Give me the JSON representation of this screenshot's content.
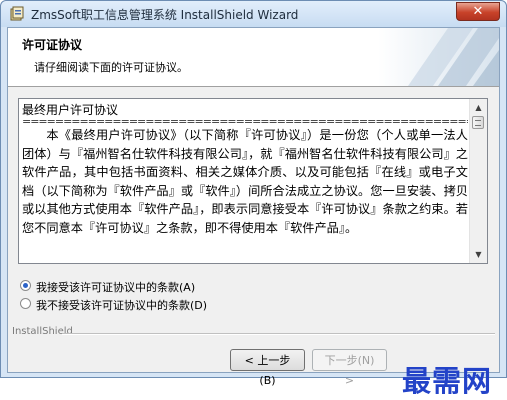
{
  "window": {
    "title": "ZmsSoft职工信息管理系统 InstallShield Wizard",
    "close_label": "✕"
  },
  "banner": {
    "title": "许可证协议",
    "subtitle": "请仔细阅读下面的许可证协议。"
  },
  "license": {
    "heading": "最终用户许可协议",
    "rule": "================================================================================",
    "body": "本《最终用户许可协议》（以下简称『许可协议』）是一份您（个人或单一法人团体）与『福州智名仕软件科技有限公司』，就『福州智名仕软件科技有限公司』之软件产品，其中包括书面资料、相关之媒体介质、以及可能包括『在线』或电子文档（以下简称为『软件产品』或『软件』）间所合法成立之协议。您一旦安装、拷贝或以其他方式使用本『软件产品』，即表示同意接受本『许可协议』条款之约束。若您不同意本『许可协议』之条款，即不得使用本『软件产品』。"
  },
  "options": {
    "accept": {
      "label": "我接受该许可证协议中的条款(A)",
      "checked": true
    },
    "decline": {
      "label": "我不接受该许可证协议中的条款(D)",
      "checked": false
    }
  },
  "footer": {
    "group_label": "InstallShield",
    "back_label": "< 上一步(B)",
    "next_label": "下一步(N) >"
  },
  "watermark": "最需网"
}
